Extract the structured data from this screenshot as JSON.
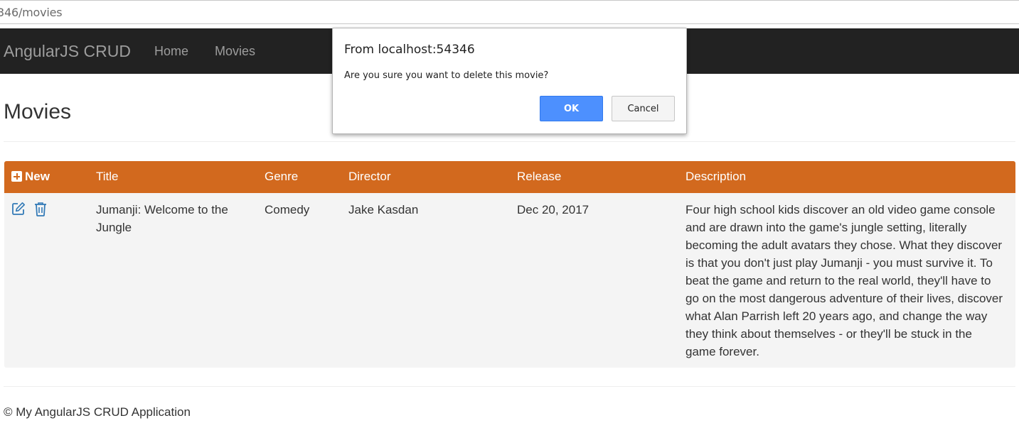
{
  "browser": {
    "url": "346/movies"
  },
  "navbar": {
    "brand": "AngularJS CRUD",
    "links": [
      "Home",
      "Movies"
    ]
  },
  "page": {
    "title": "Movies"
  },
  "table": {
    "new_label": "New",
    "columns": [
      "Title",
      "Genre",
      "Director",
      "Release",
      "Description"
    ],
    "rows": [
      {
        "title": "Jumanji: Welcome to the Jungle",
        "genre": "Comedy",
        "director": "Jake Kasdan",
        "release": "Dec 20, 2017",
        "description": "Four high school kids discover an old video game console and are drawn into the game's jungle setting, literally becoming the adult avatars they chose. What they discover is that you don't just play Jumanji - you must survive it. To beat the game and return to the real world, they'll have to go on the most dangerous adventure of their lives, discover what Alan Parrish left 20 years ago, and change the way they think about themselves - or they'll be stuck in the game forever.",
        "actions": [
          "edit-icon",
          "trash-icon"
        ]
      }
    ]
  },
  "footer": {
    "text": "© My AngularJS CRUD Application"
  },
  "dialog": {
    "title": "From localhost:54346",
    "message": "Are you sure you want to delete this movie?",
    "ok_label": "OK",
    "cancel_label": "Cancel"
  },
  "colors": {
    "navbar_bg": "#222222",
    "table_header_bg": "#d2691e",
    "row_bg": "#f4f4f4",
    "icon_color": "#337ab7",
    "ok_button_bg": "#4d90fe"
  }
}
